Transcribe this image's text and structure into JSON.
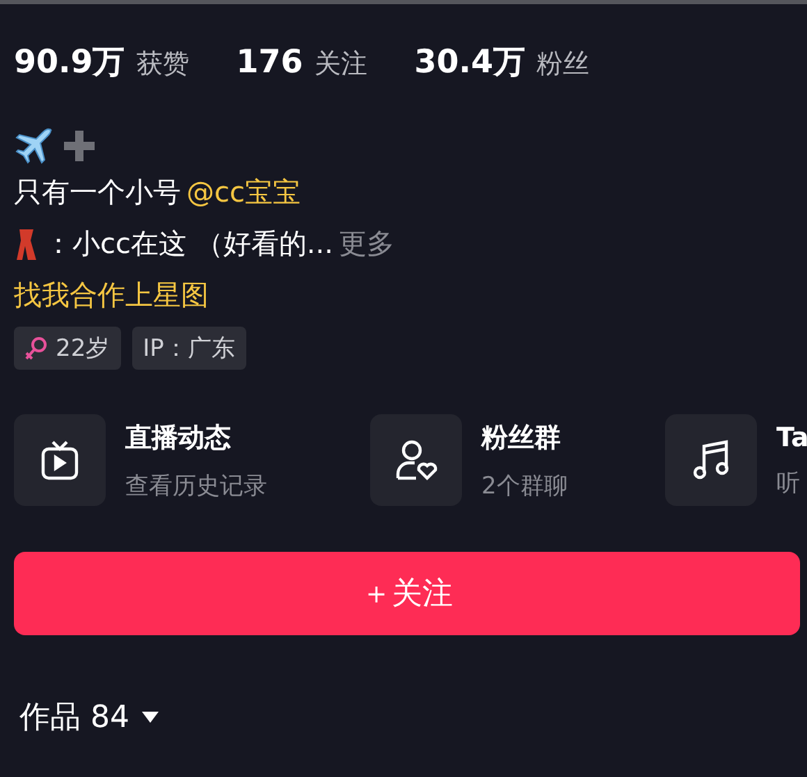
{
  "stats": [
    {
      "count": "90.9万",
      "caption": "获赞"
    },
    {
      "count": "176",
      "caption": "关注"
    },
    {
      "count": "30.4万",
      "caption": "粉丝"
    }
  ],
  "bio": {
    "mention_line": {
      "text": "只有一个小号",
      "mention": "@cc宝宝"
    },
    "note_line": {
      "text": "：小cc在这 （好看的...",
      "more": "更多"
    },
    "link": "找我合作上星图"
  },
  "tags": [
    {
      "kind": "age",
      "text": "22岁"
    },
    {
      "kind": "ip",
      "text": "IP：广东"
    }
  ],
  "cards": [
    {
      "kind": "tv",
      "title": "直播动态",
      "subtitle": "查看历史记录"
    },
    {
      "kind": "fans",
      "title": "粉丝群",
      "subtitle": "2个群聊"
    },
    {
      "kind": "music",
      "title": "Ta",
      "subtitle": "听"
    }
  ],
  "follow_button": "＋关注",
  "tabs": [
    {
      "label": "作品 84",
      "selected": true
    }
  ]
}
